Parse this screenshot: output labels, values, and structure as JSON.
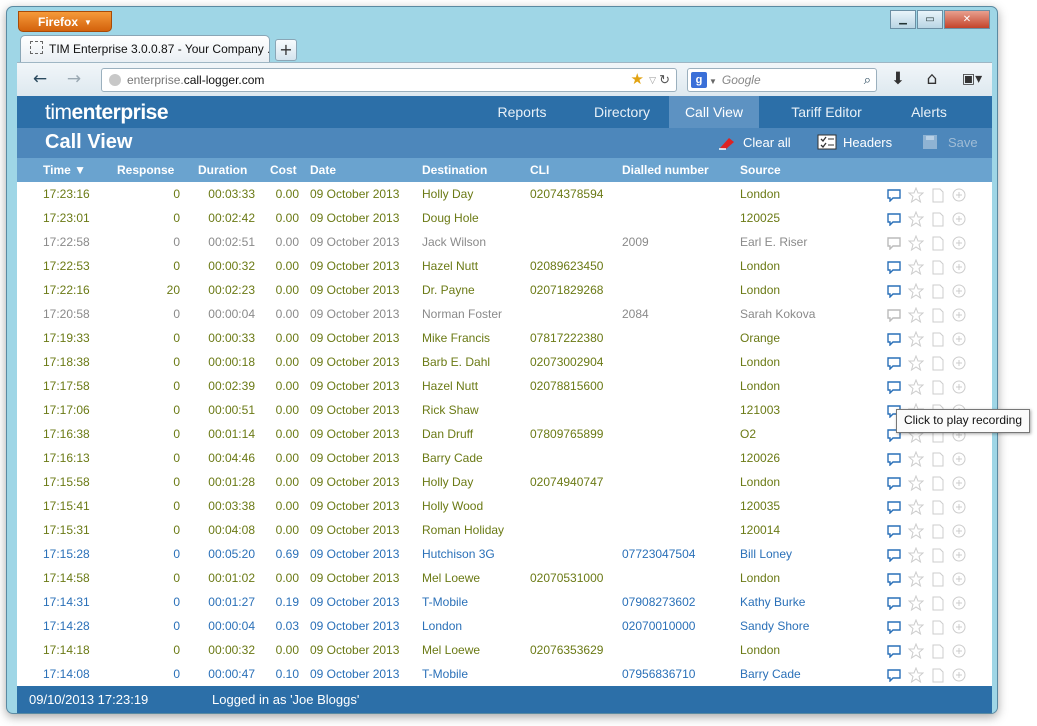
{
  "browser": {
    "firefox_button": "Firefox",
    "tab_title": "TIM Enterprise 3.0.0.87 - Your Company ...",
    "new_tab": "+",
    "url_prefix": "enterprise.",
    "url_host": "call-logger.com",
    "search_placeholder": "Google"
  },
  "app": {
    "logo_light": "tim",
    "logo_bold": "enterprise",
    "menu": [
      "Reports",
      "Directory",
      "Call View",
      "Tariff Editor",
      "Alerts"
    ],
    "active_menu": "Call View",
    "page_title": "Call View",
    "tools": {
      "clear_all": "Clear all",
      "headers": "Headers",
      "save": "Save"
    },
    "columns": [
      "Time ▼",
      "Response",
      "Duration",
      "Cost",
      "Date",
      "Destination",
      "CLI",
      "Dialled number",
      "Source"
    ],
    "tooltip": "Click to play recording",
    "status": {
      "datetime": "09/10/2013 17:23:19",
      "login": "Logged in as 'Joe Bloggs'"
    }
  },
  "colors": {
    "olive": "#6b7a15",
    "blue": "#2a70b8",
    "gray": "#8a8a8a",
    "header": "#2c6fa8"
  },
  "calls": [
    {
      "time": "17:23:16",
      "response": "0",
      "duration": "00:03:33",
      "cost": "0.00",
      "date": "09 October 2013",
      "destination": "Holly Day",
      "cli": "02074378594",
      "dialled": "",
      "source": "London",
      "tone": "olive"
    },
    {
      "time": "17:23:01",
      "response": "0",
      "duration": "00:02:42",
      "cost": "0.00",
      "date": "09 October 2013",
      "destination": "Doug Hole",
      "cli": "",
      "dialled": "",
      "source": "120025",
      "tone": "olive"
    },
    {
      "time": "17:22:58",
      "response": "0",
      "duration": "00:02:51",
      "cost": "0.00",
      "date": "09 October 2013",
      "destination": "Jack Wilson",
      "cli": "",
      "dialled": "2009",
      "source": "Earl E. Riser",
      "tone": "gray"
    },
    {
      "time": "17:22:53",
      "response": "0",
      "duration": "00:00:32",
      "cost": "0.00",
      "date": "09 October 2013",
      "destination": "Hazel Nutt",
      "cli": "02089623450",
      "dialled": "",
      "source": "London",
      "tone": "olive"
    },
    {
      "time": "17:22:16",
      "response": "20",
      "duration": "00:02:23",
      "cost": "0.00",
      "date": "09 October 2013",
      "destination": "Dr. Payne",
      "cli": "02071829268",
      "dialled": "",
      "source": "London",
      "tone": "olive"
    },
    {
      "time": "17:20:58",
      "response": "0",
      "duration": "00:00:04",
      "cost": "0.00",
      "date": "09 October 2013",
      "destination": "Norman Foster",
      "cli": "",
      "dialled": "2084",
      "source": "Sarah Kokova",
      "tone": "gray"
    },
    {
      "time": "17:19:33",
      "response": "0",
      "duration": "00:00:33",
      "cost": "0.00",
      "date": "09 October 2013",
      "destination": "Mike Francis",
      "cli": "07817222380",
      "dialled": "",
      "source": "Orange",
      "tone": "olive"
    },
    {
      "time": "17:18:38",
      "response": "0",
      "duration": "00:00:18",
      "cost": "0.00",
      "date": "09 October 2013",
      "destination": "Barb E. Dahl",
      "cli": "02073002904",
      "dialled": "",
      "source": "London",
      "tone": "olive"
    },
    {
      "time": "17:17:58",
      "response": "0",
      "duration": "00:02:39",
      "cost": "0.00",
      "date": "09 October 2013",
      "destination": "Hazel Nutt",
      "cli": "02078815600",
      "dialled": "",
      "source": "London",
      "tone": "olive"
    },
    {
      "time": "17:17:06",
      "response": "0",
      "duration": "00:00:51",
      "cost": "0.00",
      "date": "09 October 2013",
      "destination": "Rick Shaw",
      "cli": "",
      "dialled": "",
      "source": "121003",
      "tone": "olive"
    },
    {
      "time": "17:16:38",
      "response": "0",
      "duration": "00:01:14",
      "cost": "0.00",
      "date": "09 October 2013",
      "destination": "Dan Druff",
      "cli": "07809765899",
      "dialled": "",
      "source": "O2",
      "tone": "olive"
    },
    {
      "time": "17:16:13",
      "response": "0",
      "duration": "00:04:46",
      "cost": "0.00",
      "date": "09 October 2013",
      "destination": "Barry Cade",
      "cli": "",
      "dialled": "",
      "source": "120026",
      "tone": "olive"
    },
    {
      "time": "17:15:58",
      "response": "0",
      "duration": "00:01:28",
      "cost": "0.00",
      "date": "09 October 2013",
      "destination": "Holly Day",
      "cli": "02074940747",
      "dialled": "",
      "source": "London",
      "tone": "olive"
    },
    {
      "time": "17:15:41",
      "response": "0",
      "duration": "00:03:38",
      "cost": "0.00",
      "date": "09 October 2013",
      "destination": "Holly Wood",
      "cli": "",
      "dialled": "",
      "source": "120035",
      "tone": "olive"
    },
    {
      "time": "17:15:31",
      "response": "0",
      "duration": "00:04:08",
      "cost": "0.00",
      "date": "09 October 2013",
      "destination": "Roman Holiday",
      "cli": "",
      "dialled": "",
      "source": "120014",
      "tone": "olive"
    },
    {
      "time": "17:15:28",
      "response": "0",
      "duration": "00:05:20",
      "cost": "0.69",
      "date": "09 October 2013",
      "destination": "Hutchison 3G",
      "cli": "",
      "dialled": "07723047504",
      "source": "Bill Loney",
      "tone": "blue"
    },
    {
      "time": "17:14:58",
      "response": "0",
      "duration": "00:01:02",
      "cost": "0.00",
      "date": "09 October 2013",
      "destination": "Mel Loewe",
      "cli": "02070531000",
      "dialled": "",
      "source": "London",
      "tone": "olive"
    },
    {
      "time": "17:14:31",
      "response": "0",
      "duration": "00:01:27",
      "cost": "0.19",
      "date": "09 October 2013",
      "destination": "T-Mobile",
      "cli": "",
      "dialled": "07908273602",
      "source": "Kathy Burke",
      "tone": "blue"
    },
    {
      "time": "17:14:28",
      "response": "0",
      "duration": "00:00:04",
      "cost": "0.03",
      "date": "09 October 2013",
      "destination": "London",
      "cli": "",
      "dialled": "02070010000",
      "source": "Sandy Shore",
      "tone": "blue"
    },
    {
      "time": "17:14:18",
      "response": "0",
      "duration": "00:00:32",
      "cost": "0.00",
      "date": "09 October 2013",
      "destination": "Mel Loewe",
      "cli": "02076353629",
      "dialled": "",
      "source": "London",
      "tone": "olive"
    },
    {
      "time": "17:14:08",
      "response": "0",
      "duration": "00:00:47",
      "cost": "0.10",
      "date": "09 October 2013",
      "destination": "T-Mobile",
      "cli": "",
      "dialled": "07956836710",
      "source": "Barry Cade",
      "tone": "blue"
    }
  ]
}
